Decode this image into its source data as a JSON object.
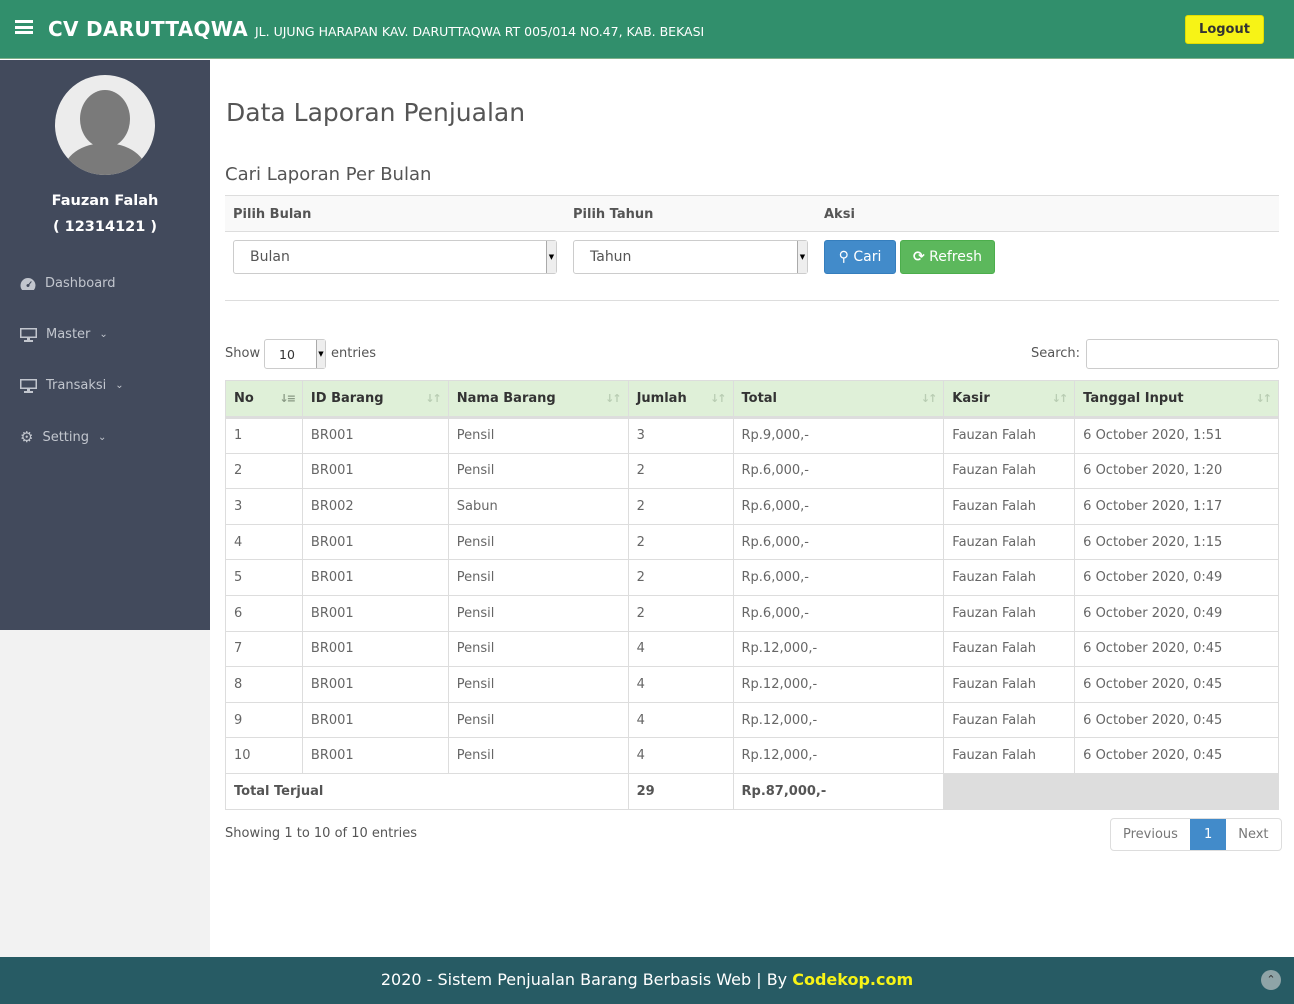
{
  "header": {
    "brand": "CV DARUTTAQWA",
    "address": "JL. UJUNG HARAPAN KAV. DARUTTAQWA RT 005/014 NO.47, KAB. BEKASI",
    "logout": "Logout"
  },
  "user": {
    "name": "Fauzan Falah",
    "id": "( 12314121 )"
  },
  "sidebar": {
    "items": [
      {
        "label": "Dashboard",
        "icon": "dashboard-icon"
      },
      {
        "label": "Master",
        "icon": "desktop-icon"
      },
      {
        "label": "Transaksi",
        "icon": "desktop-icon"
      },
      {
        "label": "Setting",
        "icon": "gear-icon"
      }
    ]
  },
  "page": {
    "title": "Data Laporan Penjualan",
    "subtitle": "Cari Laporan Per Bulan"
  },
  "filter": {
    "month_label": "Pilih Bulan",
    "year_label": "Pilih Tahun",
    "action_label": "Aksi",
    "month_value": "Bulan",
    "year_value": "Tahun",
    "search_btn": "Cari",
    "refresh_btn": "Refresh",
    "colors": {
      "search": "#428bca",
      "refresh": "#5cb85c"
    }
  },
  "table_controls": {
    "show": "Show",
    "length": "10",
    "entries": "entries",
    "search_label": "Search:",
    "search_value": ""
  },
  "table": {
    "columns": [
      "No",
      "ID Barang",
      "Nama Barang",
      "Jumlah",
      "Total",
      "Kasir",
      "Tanggal Input"
    ],
    "rows": [
      [
        "1",
        "BR001",
        "Pensil",
        "3",
        "Rp.9,000,-",
        "Fauzan Falah",
        "6 October 2020, 1:51"
      ],
      [
        "2",
        "BR001",
        "Pensil",
        "2",
        "Rp.6,000,-",
        "Fauzan Falah",
        "6 October 2020, 1:20"
      ],
      [
        "3",
        "BR002",
        "Sabun",
        "2",
        "Rp.6,000,-",
        "Fauzan Falah",
        "6 October 2020, 1:17"
      ],
      [
        "4",
        "BR001",
        "Pensil",
        "2",
        "Rp.6,000,-",
        "Fauzan Falah",
        "6 October 2020, 1:15"
      ],
      [
        "5",
        "BR001",
        "Pensil",
        "2",
        "Rp.6,000,-",
        "Fauzan Falah",
        "6 October 2020, 0:49"
      ],
      [
        "6",
        "BR001",
        "Pensil",
        "2",
        "Rp.6,000,-",
        "Fauzan Falah",
        "6 October 2020, 0:49"
      ],
      [
        "7",
        "BR001",
        "Pensil",
        "4",
        "Rp.12,000,-",
        "Fauzan Falah",
        "6 October 2020, 0:45"
      ],
      [
        "8",
        "BR001",
        "Pensil",
        "4",
        "Rp.12,000,-",
        "Fauzan Falah",
        "6 October 2020, 0:45"
      ],
      [
        "9",
        "BR001",
        "Pensil",
        "4",
        "Rp.12,000,-",
        "Fauzan Falah",
        "6 October 2020, 0:45"
      ],
      [
        "10",
        "BR001",
        "Pensil",
        "4",
        "Rp.12,000,-",
        "Fauzan Falah",
        "6 October 2020, 0:45"
      ]
    ],
    "footer": {
      "label": "Total Terjual",
      "jumlah": "29",
      "total": "Rp.87,000,-"
    }
  },
  "pagination": {
    "info": "Showing 1 to 10 of 10 entries",
    "previous": "Previous",
    "current": "1",
    "next": "Next"
  },
  "footer": {
    "text": "2020 - Sistem Penjualan Barang Berbasis Web | By ",
    "link": "Codekop.com"
  }
}
